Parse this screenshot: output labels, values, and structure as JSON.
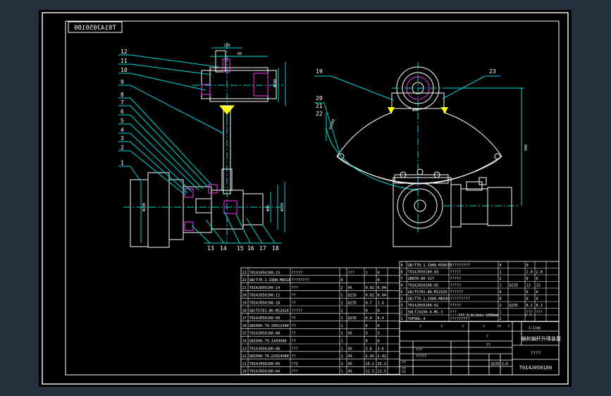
{
  "drawing": {
    "number_mirrored": "T014J050100",
    "number": "T014J050100",
    "title": "蜗轮蜗杆升降装置",
    "title_unknown": "????",
    "scale_note": "1:1(m)"
  },
  "callouts_left": [
    "12",
    "11",
    "10",
    "9",
    "8",
    "7",
    "6",
    "5",
    "4",
    "3",
    "2",
    "1"
  ],
  "callouts_bottom": [
    "13",
    "14",
    "15",
    "16",
    "17",
    "18"
  ],
  "callouts_right": [
    "19",
    "20",
    "21",
    "22",
    "23"
  ],
  "bom_lower": [
    [
      "23",
      "T014J050100-15",
      "?????",
      "",
      "???",
      "1",
      "0",
      ""
    ],
    [
      "22",
      "GB/T70.1-1988-M6X16",
      "????????",
      "4",
      "",
      "",
      "0",
      ""
    ],
    [
      "21",
      "T014J050100-14",
      "???",
      "2",
      "45",
      "0.02",
      "0.04",
      ""
    ],
    [
      "20",
      "T014J050100-11",
      "??",
      "2",
      "Q235",
      "0.02",
      "0.04",
      ""
    ],
    [
      "19",
      "T014J050100-10",
      "??",
      "2",
      "Q235",
      "0.7",
      "1.4",
      ""
    ],
    [
      "18",
      "GB/T5781-86-M12X24",
      "?????",
      "2",
      "",
      "0",
      "0",
      ""
    ],
    [
      "17",
      "T014J050100-09",
      "??",
      "1",
      "Q235",
      "0.4",
      "0.4",
      ""
    ],
    [
      "16",
      "GB1096-79-20X12X40",
      "??",
      "1",
      "",
      "0",
      "0",
      ""
    ],
    [
      "15",
      "T014J050100-08",
      "??",
      "1",
      "45",
      "3",
      "3",
      ""
    ],
    [
      "14",
      "GB1096-79-14X9X80",
      "??",
      "1",
      "",
      "0",
      "0",
      ""
    ],
    [
      "13",
      "T014J050100-06",
      "???",
      "1",
      "45",
      "3.6",
      "3.6",
      ""
    ],
    [
      "12",
      "GB1096-79-22X14X80",
      "??",
      "1",
      "45",
      "2.42",
      "2.42",
      ""
    ],
    [
      "11",
      "T014J050100-05",
      "??1",
      "1",
      "45",
      "15.2",
      "15.2",
      ""
    ],
    [
      "10",
      "T014J050100-04",
      "???",
      "1",
      "45",
      "12.5",
      "12.5",
      ""
    ]
  ],
  "bom_upper": [
    [
      "9",
      "GB/T70.1-1988-M10X35",
      "?????????",
      "4",
      "",
      "0",
      ""
    ],
    [
      "8",
      "T014J050100-03",
      "?????",
      "1",
      "",
      "2.8",
      "2.8"
    ],
    [
      "7",
      "GB876-86-117",
      "?????",
      "2",
      "",
      "0",
      "0"
    ],
    [
      "6",
      "T014J050100-02",
      "?????",
      "1",
      "Q235",
      "13",
      "13"
    ],
    [
      "5",
      "GB/T5781-86-M12X25",
      "??????",
      "4",
      "",
      "0",
      "0"
    ],
    [
      "4",
      "GB/T70.1-1988-M8X40",
      "?????????",
      "8",
      "",
      "0",
      "0"
    ],
    [
      "3",
      "T014J050100-01",
      "?????",
      "2",
      "Q235",
      "8.2",
      "8.2"
    ],
    [
      "2",
      "SWLT24100-6-MC-5",
      "???",
      "1",
      "",
      "???",
      "???"
    ],
    [
      "1",
      "YVP90L-4",
      "?????????",
      "1",
      "",
      "",
      ""
    ]
  ],
  "title_block": {
    "motor_note": "??? 3.8r/min 1000mm",
    "placeholder": "?",
    "row_q": [
      "?",
      "?",
      "?",
      "?",
      "??",
      "?"
    ],
    "sign_rows": [
      "???",
      "?????",
      "??",
      "??",
      "??"
    ],
    "sheet_label": "??",
    "count_label": "? ?",
    "material": "Q235",
    "weight": "1:6"
  },
  "dims_left": [
    "120",
    "60",
    "Φ100",
    "Φ85",
    "Φ200",
    "Φ120"
  ],
  "dims_right": [
    "R1000",
    "900",
    "Φ40"
  ],
  "colors": {
    "bg_outer": "#25313c",
    "sheet": "#000000",
    "frame": "#ffffff",
    "centerline": "#00d7d7",
    "callout": "#00d7d7",
    "part_line": "#ffffff",
    "highlight_magenta": "#ff33ff",
    "highlight_yellow": "#ffff00",
    "dim": "#00d7d7",
    "text": "#ffffff"
  }
}
